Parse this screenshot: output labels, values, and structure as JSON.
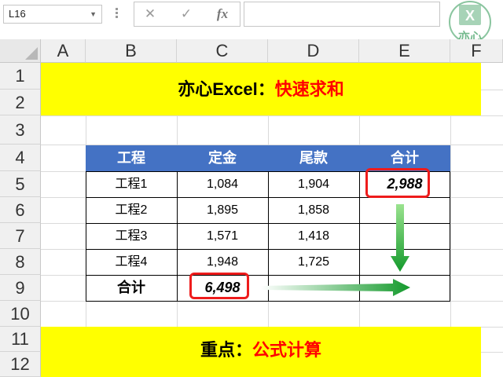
{
  "formula_bar": {
    "name_box": "L16",
    "cancel_icon": "cancel-icon",
    "confirm_icon": "check-icon",
    "fx_label": "fx",
    "formula": ""
  },
  "logo": {
    "top_text": "X",
    "bottom_text": "亦心",
    "color": "#3c9e5f"
  },
  "columns": [
    "A",
    "B",
    "C",
    "D",
    "E",
    "F"
  ],
  "rows": [
    "1",
    "2",
    "3",
    "4",
    "5",
    "6",
    "7",
    "8",
    "9",
    "10",
    "11",
    "12"
  ],
  "title": {
    "black": "亦心Excel：",
    "red": "快速求和"
  },
  "table": {
    "headers": [
      "工程",
      "定金",
      "尾款",
      "合计"
    ],
    "rows": [
      [
        "工程1",
        "1,084",
        "1,904",
        "2,988"
      ],
      [
        "工程2",
        "1,895",
        "1,858",
        ""
      ],
      [
        "工程3",
        "1,571",
        "1,418",
        ""
      ],
      [
        "工程4",
        "1,948",
        "1,725",
        ""
      ]
    ],
    "total_label": "合计",
    "total_value": "6,498"
  },
  "footer": {
    "black": "重点：",
    "red": "公式计算"
  },
  "colors": {
    "yellow": "#ffff00",
    "header_blue": "#4472c4",
    "callout_red": "#ee1c1c",
    "arrow_green": "#20a030"
  }
}
